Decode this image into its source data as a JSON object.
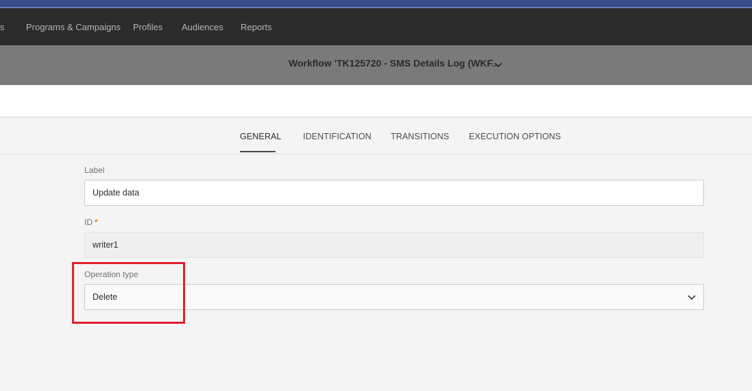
{
  "nav": {
    "items": [
      {
        "label": "s"
      },
      {
        "label": "Programs & Campaigns"
      },
      {
        "label": "Profiles"
      },
      {
        "label": "Audiences"
      },
      {
        "label": "Reports"
      }
    ]
  },
  "workflow": {
    "title": "Workflow 'TK125720 - SMS Details Log (WKF..."
  },
  "tabs": [
    {
      "label": "GENERAL",
      "active": true
    },
    {
      "label": "IDENTIFICATION"
    },
    {
      "label": "TRANSITIONS"
    },
    {
      "label": "EXECUTION OPTIONS"
    }
  ],
  "form": {
    "label_field": {
      "label": "Label",
      "value": "Update data"
    },
    "id_field": {
      "label": "ID",
      "required_mark": "*",
      "value": "writer1"
    },
    "operation_type": {
      "label": "Operation type",
      "value": "Delete"
    }
  },
  "colors": {
    "navbar": "#2b2b2b",
    "titlebar": "#7a7a7a",
    "highlight": "#e0202c",
    "required": "#e68619"
  },
  "icons": {
    "workflow_dropdown": "chevron-down-icon",
    "select_dropdown": "chevron-down-icon"
  }
}
